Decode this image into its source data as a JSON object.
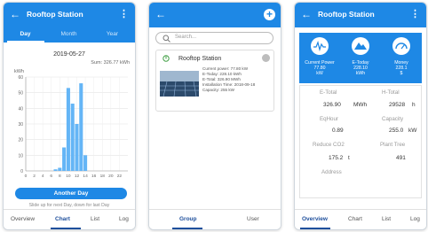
{
  "colors": {
    "primary": "#1e88e5",
    "dark_blue": "#1e4f9c",
    "bars": "#64b5f6"
  },
  "screen1": {
    "title": "Rooftop Station",
    "tabs": [
      "Day",
      "Month",
      "Year"
    ],
    "date": "2019-05-27",
    "sum": "Sum: 326.77 kWh",
    "button": "Another Day",
    "hint": "Slide up for next Day, down for last Day",
    "nav": [
      "Overview",
      "Chart",
      "List",
      "Log"
    ]
  },
  "screen2": {
    "search_placeholder": "Search...",
    "station": {
      "name": "Rooftop Station",
      "details": [
        "Current power: 77.80 kW",
        "E-Today: 228.10 kWh",
        "E-Total: 326.90 MWh",
        "Installation Time: 2018-09-18",
        "Capacity: 255 kW"
      ]
    },
    "nav": [
      "Group",
      "User"
    ]
  },
  "screen3": {
    "title": "Rooftop Station",
    "tiles": [
      {
        "label": "Current Power",
        "value": "77.80",
        "unit": "kW",
        "icon": "gauge-icon"
      },
      {
        "label": "E-Today",
        "value": "228.10",
        "unit": "kWh",
        "icon": "mountain-icon"
      },
      {
        "label": "Money",
        "value": "228.1",
        "unit": "$",
        "icon": "speedometer-icon"
      }
    ],
    "stats": [
      {
        "label": "E-Total",
        "value": "326.90",
        "unit": "MWh"
      },
      {
        "label": "H-Total",
        "value": "29528",
        "unit": "h"
      },
      {
        "label": "EqHour",
        "value": "0.89",
        "unit": ""
      },
      {
        "label": "Capacity",
        "value": "255.0",
        "unit": "kW"
      },
      {
        "label": "Reduce CO2",
        "value": "175.2",
        "unit": "t"
      },
      {
        "label": "Plant Tree",
        "value": "491",
        "unit": ""
      },
      {
        "label": "Address",
        "value": "",
        "unit": ""
      }
    ],
    "nav": [
      "Overview",
      "Chart",
      "List",
      "Log"
    ]
  },
  "chart_data": {
    "type": "bar",
    "ylabel": "kWh",
    "ylim": [
      0,
      60
    ],
    "yticks": [
      0,
      10,
      20,
      30,
      40,
      50,
      60
    ],
    "xticks": [
      0,
      2,
      4,
      6,
      8,
      10,
      12,
      14,
      16,
      18,
      20,
      22
    ],
    "x": [
      7,
      8,
      9,
      10,
      11,
      12,
      13,
      14
    ],
    "values": [
      1,
      2,
      15,
      53,
      43,
      30,
      56,
      10
    ]
  }
}
